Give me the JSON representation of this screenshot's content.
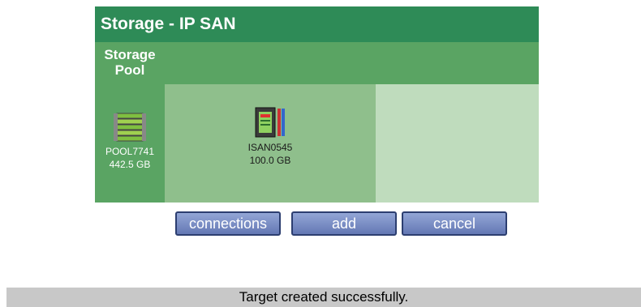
{
  "header": {
    "title": "Storage - IP SAN"
  },
  "table": {
    "pool_column_header": "Storage Pool"
  },
  "pool": {
    "name": "POOL7741",
    "size": "442.5 GB",
    "icon": "storage-pool-icon"
  },
  "target": {
    "name": "ISAN0545",
    "size": "100.0 GB",
    "icon": "iscsi-target-icon"
  },
  "buttons": {
    "connections": "connections",
    "add": "add",
    "cancel": "cancel"
  },
  "status": {
    "message": "Target created successfully."
  },
  "colors": {
    "title_bg": "#2e8b57",
    "header_bg": "#5aa463",
    "target_bg": "#8fbf8c",
    "empty_bg": "#bfdcbd",
    "button_bg": "#7b8fc8"
  }
}
